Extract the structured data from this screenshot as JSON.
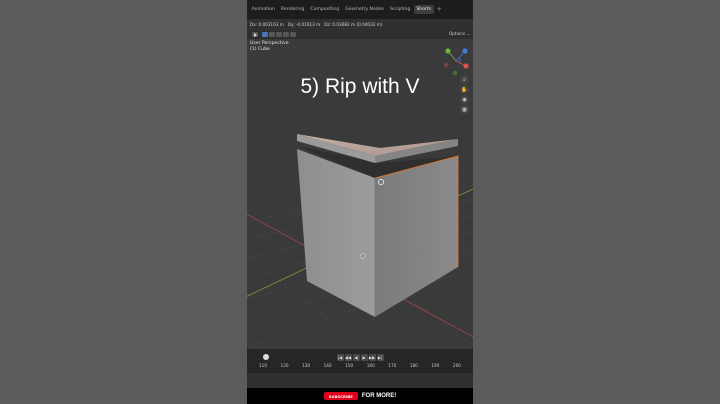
{
  "workspace_tabs": [
    {
      "label": "Animation",
      "active": false
    },
    {
      "label": "Rendering",
      "active": false
    },
    {
      "label": "Compositing",
      "active": false
    },
    {
      "label": "Geometry Nodes",
      "active": false
    },
    {
      "label": "Scripting",
      "active": false
    },
    {
      "label": "Shorts",
      "active": true
    }
  ],
  "tab_add_label": "+",
  "status": {
    "dx": "Dx: 0.003163 m",
    "dy": "Dy: -0.01613 m",
    "dz": "Dz: 0.03682 m (0.04032 m)"
  },
  "viewport_header": {
    "options_label": "Options ⌄"
  },
  "view_info": {
    "perspective": "User Perspective",
    "object": "(1) Cube"
  },
  "caption": "5) Rip with V",
  "timeline": {
    "ruler": [
      "110",
      "120",
      "130",
      "140",
      "150",
      "160",
      "170",
      "180",
      "190",
      "200"
    ]
  },
  "subscribe": {
    "button_label": "SUBSCRIBE",
    "text": "FOR MORE!"
  },
  "colors": {
    "accent_selection": "#4a73b5",
    "edge_highlight": "#e0742a",
    "subscribe_red": "#e0001b",
    "axis_x": "#d9534f",
    "axis_y": "#6fb33f",
    "axis_z": "#3f7dd6"
  }
}
